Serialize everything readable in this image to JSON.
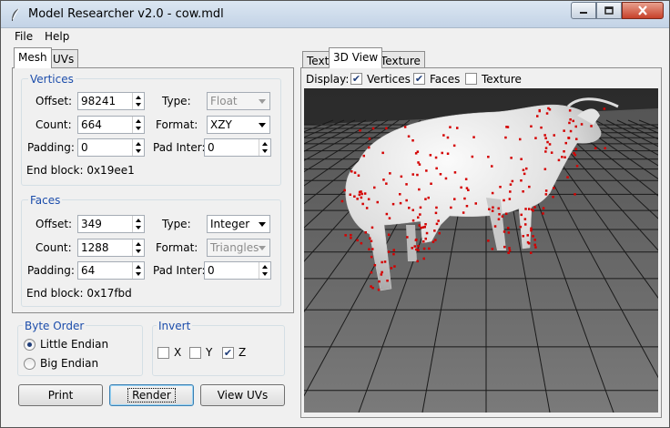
{
  "window": {
    "title": "Model Researcher v2.0 - cow.mdl",
    "controls": [
      "minimize-icon",
      "maximize-icon",
      "close-icon"
    ]
  },
  "menu": [
    "File",
    "Help"
  ],
  "left_tabs": [
    {
      "label": "Mesh",
      "active": true
    },
    {
      "label": "UVs",
      "active": false
    }
  ],
  "vertices": {
    "title": "Vertices",
    "offset_label": "Offset:",
    "offset_value": "98241",
    "count_label": "Count:",
    "count_value": "664",
    "padding_label": "Padding:",
    "padding_value": "0",
    "type_label": "Type:",
    "type_value": "Float",
    "format_label": "Format:",
    "format_value": "XZY",
    "pad_inter_label": "Pad Inter:",
    "pad_inter_value": "0",
    "end_block": "End block: 0x19ee1"
  },
  "faces": {
    "title": "Faces",
    "offset_label": "Offset:",
    "offset_value": "349",
    "count_label": "Count:",
    "count_value": "1288",
    "padding_label": "Padding:",
    "padding_value": "64",
    "type_label": "Type:",
    "type_value": "Integer",
    "format_label": "Format:",
    "format_value": "Triangles",
    "pad_inter_label": "Pad Inter:",
    "pad_inter_value": "0",
    "end_block": "End block: 0x17fbd"
  },
  "byte_order": {
    "title": "Byte Order",
    "options": [
      {
        "label": "Little Endian",
        "selected": true
      },
      {
        "label": "Big Endian",
        "selected": false
      }
    ]
  },
  "invert": {
    "title": "Invert",
    "options": [
      {
        "label": "X",
        "checked": false
      },
      {
        "label": "Y",
        "checked": false
      },
      {
        "label": "Z",
        "checked": true
      }
    ]
  },
  "buttons": {
    "print": "Print",
    "render": "Render",
    "view_uvs": "View UVs"
  },
  "right_tabs": [
    {
      "label": "Text",
      "active": false
    },
    {
      "label": "3D View",
      "active": true
    },
    {
      "label": "Texture",
      "active": false
    }
  ],
  "display": {
    "label": "Display:",
    "options": [
      {
        "label": "Vertices",
        "checked": true
      },
      {
        "label": "Faces",
        "checked": true
      },
      {
        "label": "Texture",
        "checked": false
      }
    ]
  },
  "colors": {
    "vertex_marker": "#d40000",
    "mesh": "#e8e8e8",
    "floor_grid": "#1a1a1a",
    "group_title": "#1c4dab"
  }
}
